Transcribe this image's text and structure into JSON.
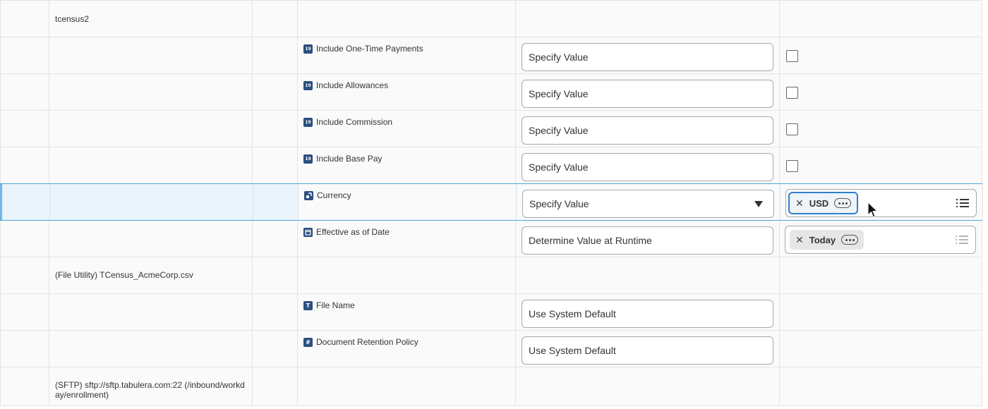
{
  "rows": {
    "tcensus": {
      "group_label": "tcensus2"
    },
    "one_time": {
      "field_label": "Include One-Time Payments",
      "field_icon": "19",
      "value_mode": "Specify Value"
    },
    "allowances": {
      "field_label": "Include Allowances",
      "field_icon": "19",
      "value_mode": "Specify Value"
    },
    "commission": {
      "field_label": "Include Commission",
      "field_icon": "19",
      "value_mode": "Specify Value"
    },
    "base_pay": {
      "field_label": "Include Base Pay",
      "field_icon": "19",
      "value_mode": "Specify Value"
    },
    "currency": {
      "field_label": "Currency",
      "field_icon": "link-icon",
      "value_mode": "Specify Value",
      "chip": "USD"
    },
    "effective_date": {
      "field_label": "Effective as of Date",
      "field_icon": "calendar-icon",
      "value_mode": "Determine Value at Runtime",
      "chip": "Today"
    },
    "file_utility": {
      "group_label": "(File Utility) TCensus_AcmeCorp.csv"
    },
    "file_name": {
      "field_label": "File Name",
      "field_icon": "T",
      "value_mode": "Use System Default"
    },
    "retention": {
      "field_label": "Document Retention Policy",
      "field_icon": "#",
      "value_mode": "Use System Default"
    },
    "sftp": {
      "group_label": "(SFTP) sftp://sftp.tabulera.com:22 (/inbound/workday/enrollment)"
    }
  },
  "colors": {
    "selected_row": "#ebf4fb",
    "selected_border": "#4aa8d8",
    "focus": "#2e7fd1",
    "field_icon": "#2c4f80"
  }
}
